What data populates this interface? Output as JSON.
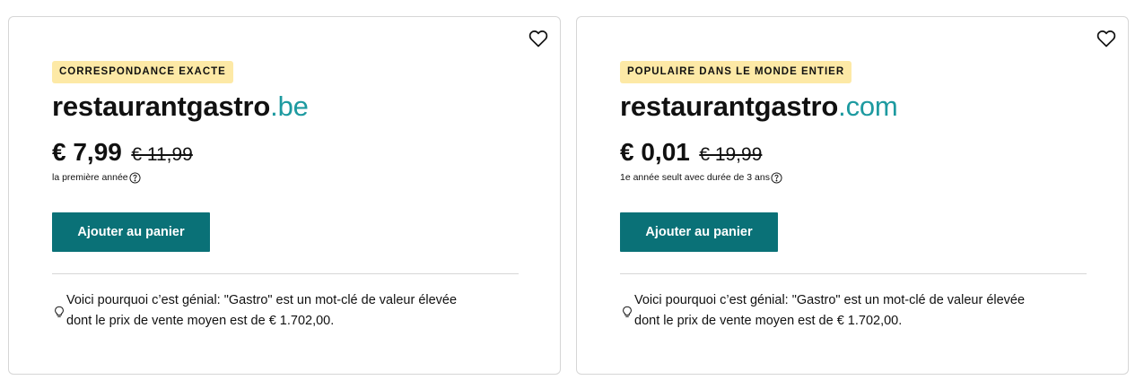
{
  "cards": [
    {
      "badge": "CORRESPONDANCE EXACTE",
      "domain_name": "restaurantgastro",
      "domain_tld": ".be",
      "price": "€ 7,99",
      "old_price": "€ 11,99",
      "price_note": "la première année",
      "cart_label": "Ajouter au panier",
      "why_line1": "Voici pourquoi c’est génial: \"Gastro\" est un mot-clé de valeur élevée",
      "why_line2": "dont le prix de vente moyen est de € 1.702,00."
    },
    {
      "badge": "POPULAIRE DANS LE MONDE ENTIER",
      "domain_name": "restaurantgastro",
      "domain_tld": ".com",
      "price": "€ 0,01",
      "old_price": "€ 19,99",
      "price_note": "1e année seult avec durée de 3 ans",
      "cart_label": "Ajouter au panier",
      "why_line1": "Voici pourquoi c’est génial: \"Gastro\" est un mot-clé de valeur élevée",
      "why_line2": "dont le prix de vente moyen est de € 1.702,00."
    }
  ],
  "icons": {
    "favorite": "heart-icon",
    "info": "info-circle-icon",
    "tip": "lightbulb-icon"
  },
  "colors": {
    "tld": "#1d9aa0",
    "button": "#0a7177",
    "badge": "#fde9a6",
    "border": "#d6d6d6"
  }
}
